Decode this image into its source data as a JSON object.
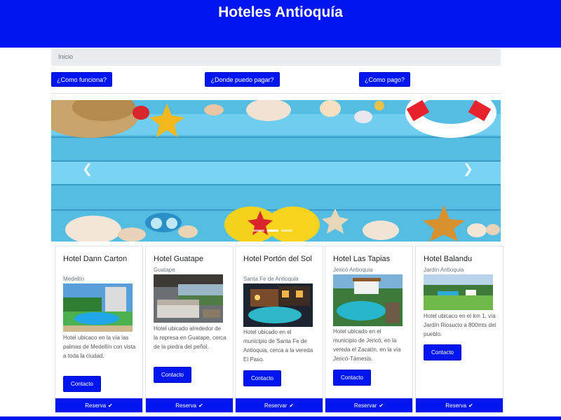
{
  "header": {
    "title": "Hoteles Antioquía"
  },
  "breadcrumb": {
    "current": "Inicio"
  },
  "nav_buttons": [
    {
      "label": "¿Como funciona?"
    },
    {
      "label": "¿Donde puedo pagar?"
    },
    {
      "label": "¿Como pago?"
    }
  ],
  "carousel": {
    "prev_icon": "chevron-left-icon",
    "next_icon": "chevron-right-icon",
    "slides_count": 3,
    "active_slide": 2
  },
  "hotels": [
    {
      "name": "Hotel Dann Carton",
      "location": "Medellín",
      "description": "Hotel ubicaco en la vía las palmas de Medellín con vista a toda la ciudad.",
      "contact_label": "Contacto",
      "reserve_label": "Reserva"
    },
    {
      "name": "Hotel Guatape",
      "location": "Guatape",
      "description": "Hotel ubicado alrededor de la represa en Guatape, cerca de la piedra del peñol.",
      "contact_label": "Contacto",
      "reserve_label": "Reserva"
    },
    {
      "name": "Hotel Portón del Sol",
      "location": "Santa Fe de Antioquia",
      "description": "Hotel ubicado en el municipio de Santa Fe de Antioquia, cerca a la vereda El Paso.",
      "contact_label": "Contacto",
      "reserve_label": "Reservar"
    },
    {
      "name": "Hotel Las Tapias",
      "location": "Jericó Antioquia",
      "description": "Hotel ubicado en el municipio de Jericó, en la vereda el Zacatín, en la vía Jericó-Támesis.",
      "contact_label": "Contacto",
      "reserve_label": "Reservar"
    },
    {
      "name": "Hotel Balandu",
      "location": "Jardín Antioquia",
      "description": "Hotel ubicaco en el km 1, vía Jardín Riosucio a 800mts del pueblo.",
      "contact_label": "Contacto",
      "reserve_label": "Reserva"
    }
  ],
  "colors": {
    "primary": "#0015f0",
    "breadcrumb_bg": "#e9ecef"
  }
}
